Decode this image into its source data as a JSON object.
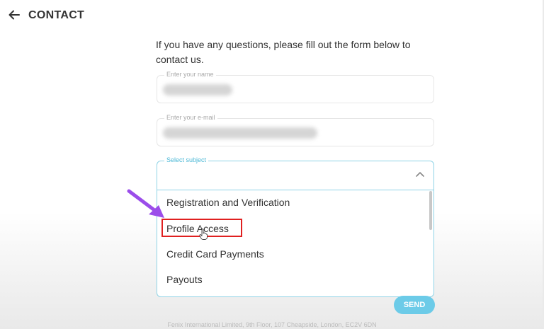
{
  "header": {
    "title": "CONTACT"
  },
  "intro": "If you have any questions, please fill out the form below to contact us.",
  "form": {
    "name_label": "Enter your name",
    "email_label": "Enter your e-mail",
    "subject_label": "Select subject",
    "subject_options": [
      "Registration and Verification",
      "Profile Access",
      "Credit Card Payments",
      "Payouts"
    ],
    "send_label": "SEND"
  },
  "footer": "Fenix International Limited, 9th Floor, 107 Cheapside, London, EC2V 6DN",
  "colors": {
    "accent": "#6ccbe8",
    "highlight": "#e02020",
    "pointer_arrow": "#9b4dea"
  }
}
